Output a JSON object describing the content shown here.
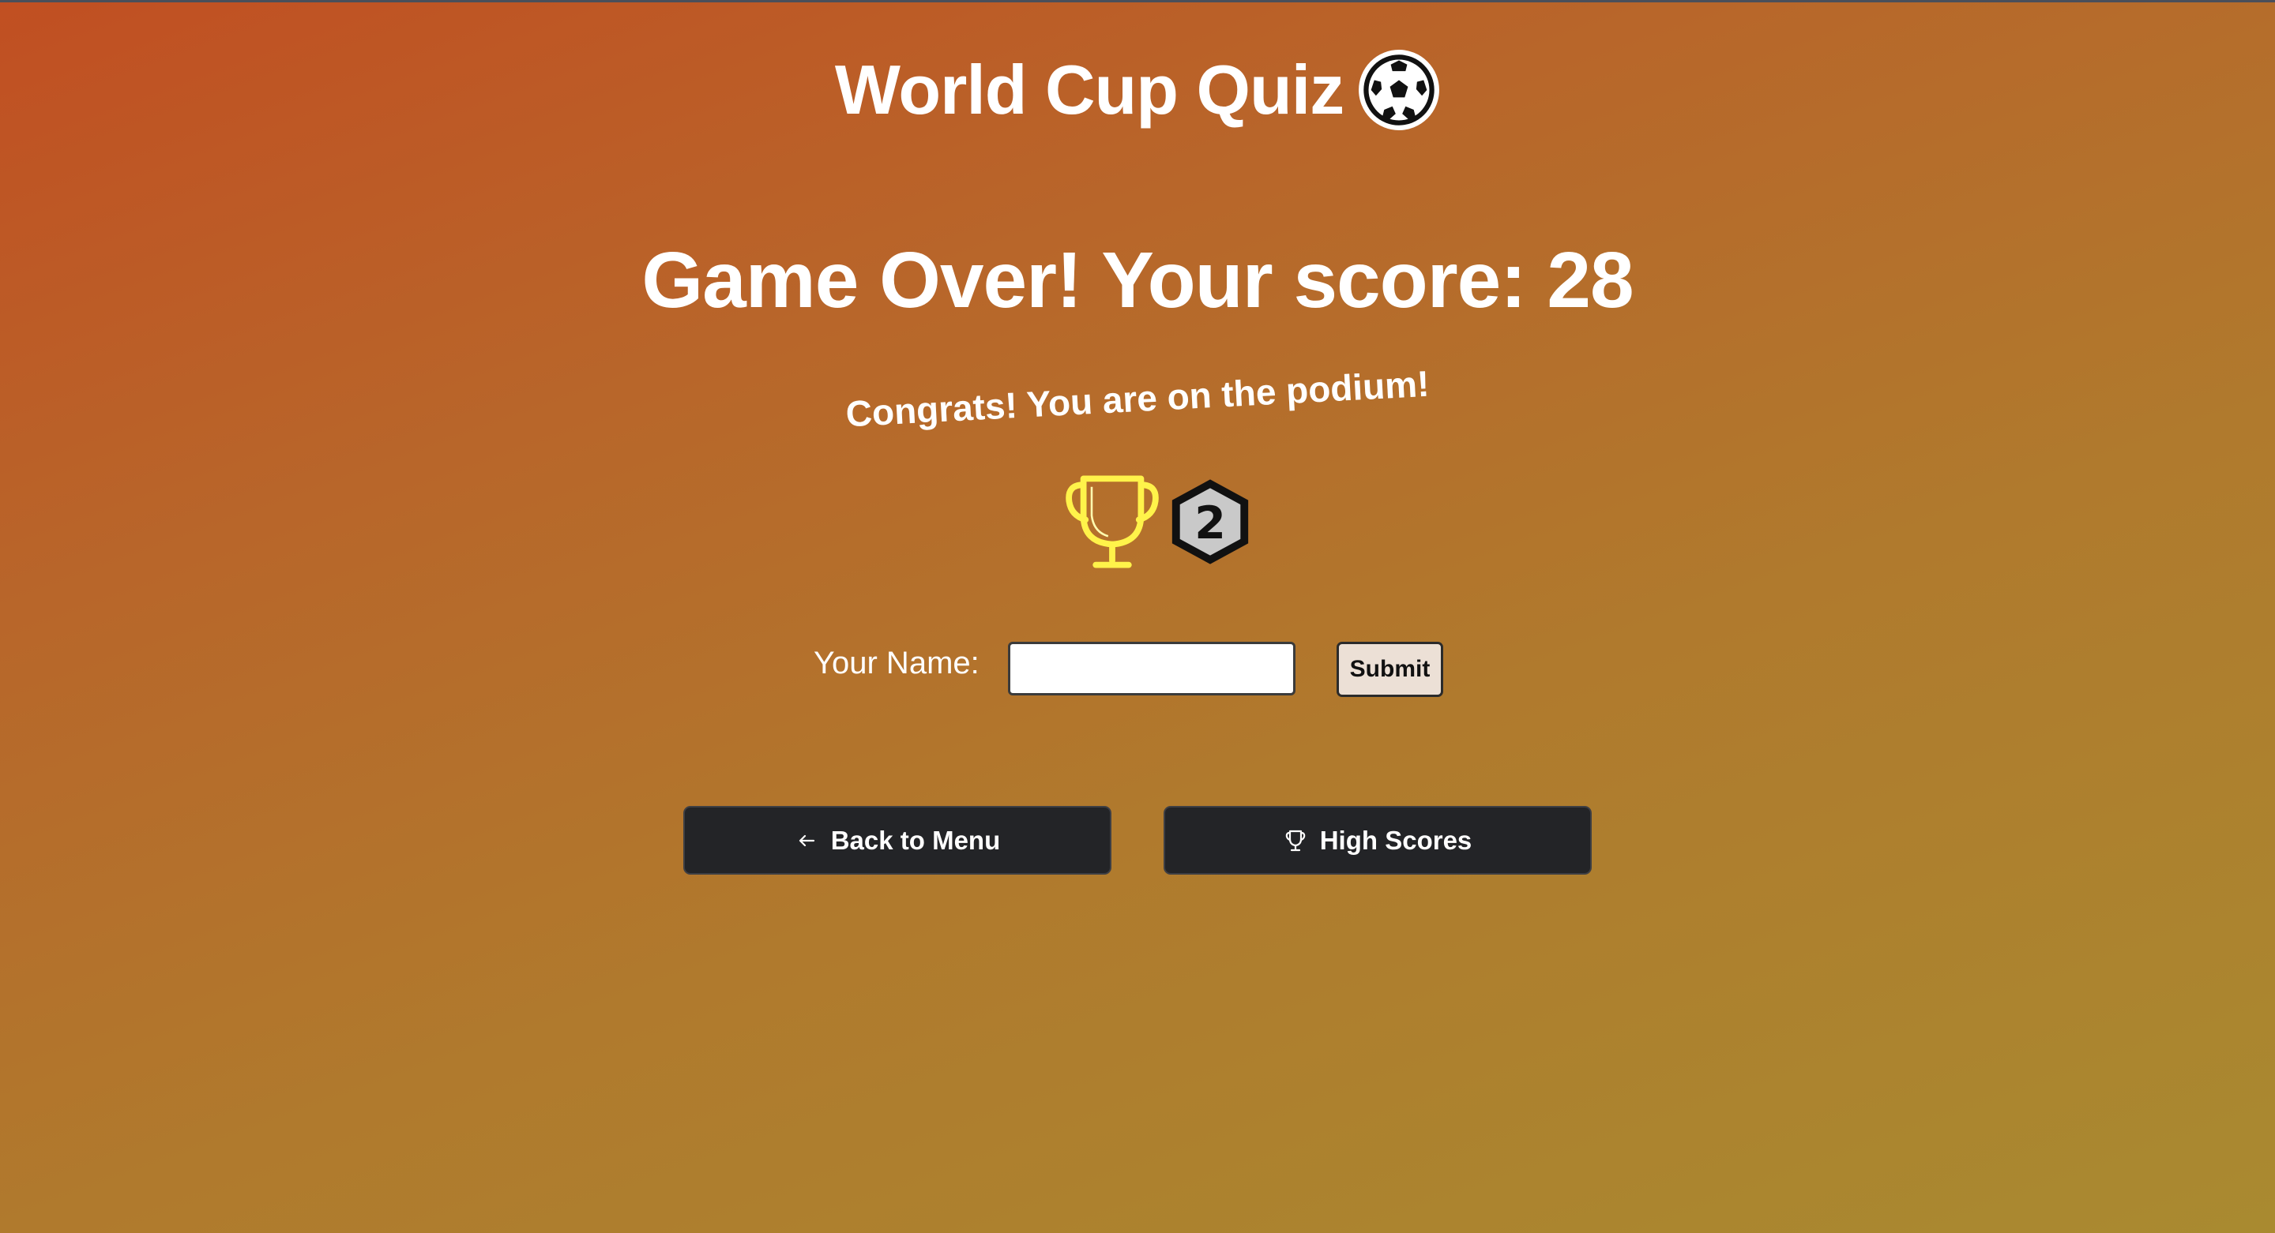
{
  "header": {
    "title": "World Cup Quiz",
    "icon": "soccer-ball-icon"
  },
  "result": {
    "heading": "Game Over! Your score: 28",
    "score": 28,
    "message": "Congrats! You are on the podium!",
    "podium_place": "2",
    "icons": [
      "trophy-icon",
      "medal-2-icon"
    ]
  },
  "name_form": {
    "label": "Your Name:",
    "input_value": "",
    "submit_label": "Submit"
  },
  "navigation": {
    "back_label": "Back to Menu",
    "back_icon": "arrow-left-icon",
    "high_scores_label": "High Scores",
    "high_scores_icon": "trophy-icon"
  },
  "colors": {
    "trophy": "#fff34a",
    "button_bg": "#232427",
    "submit_bg": "#ece0d6"
  }
}
